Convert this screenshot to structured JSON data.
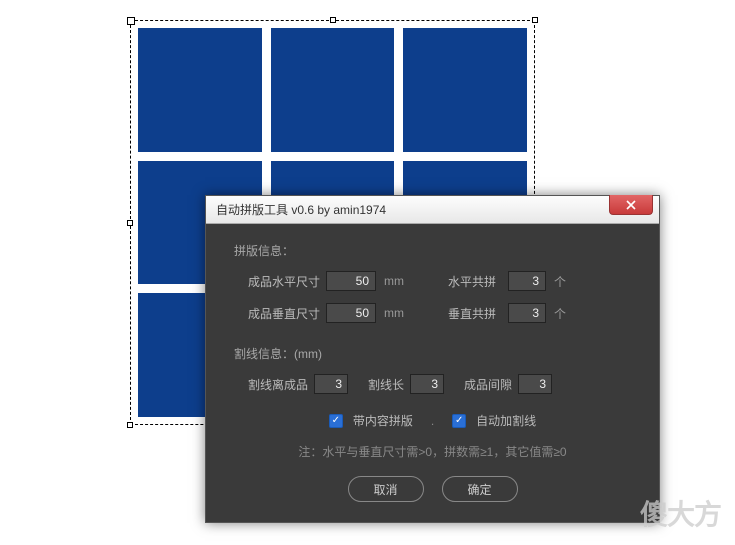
{
  "dialog": {
    "title": "自动拼版工具 v0.6   by amin1974",
    "layout_section": {
      "label": "拼版信息：",
      "width_label": "成品水平尺寸",
      "width_value": "50",
      "width_unit": "mm",
      "cols_label": "水平共拼",
      "cols_value": "3",
      "cols_unit": "个",
      "height_label": "成品垂直尺寸",
      "height_value": "50",
      "height_unit": "mm",
      "rows_label": "垂直共拼",
      "rows_value": "3",
      "rows_unit": "个"
    },
    "cut_section": {
      "label": "割线信息：(mm)",
      "offset_label": "割线离成品",
      "offset_value": "3",
      "length_label": "割线长",
      "length_value": "3",
      "gap_label": "成品间隙",
      "gap_value": "3"
    },
    "checkboxes": {
      "with_content_label": "带内容拼版",
      "with_content_checked": true,
      "auto_cutline_label": "自动加割线",
      "auto_cutline_checked": true,
      "separator": "."
    },
    "note": "注：水平与垂直尺寸需>0，拼数需≥1，其它值需≥0",
    "buttons": {
      "cancel": "取消",
      "ok": "确定"
    }
  },
  "watermark": "傻大方"
}
